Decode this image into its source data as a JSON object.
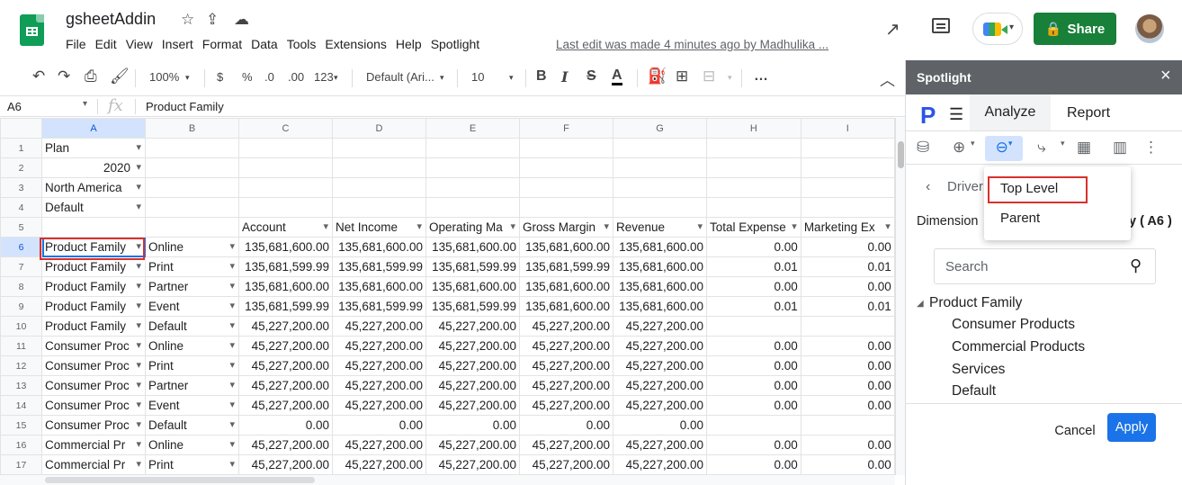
{
  "doc": {
    "title": "gsheetAddin",
    "last_edit": "Last edit was made 4 minutes ago by Madhulika ..."
  },
  "menu": [
    "File",
    "Edit",
    "View",
    "Insert",
    "Format",
    "Data",
    "Tools",
    "Extensions",
    "Help",
    "Spotlight"
  ],
  "header": {
    "share_label": "Share"
  },
  "toolbar": {
    "zoom": "100%",
    "currency": "$",
    "percent": "%",
    "dec_decrease": ".0",
    "dec_increase": ".00",
    "number_format": "123",
    "font": "Default (Ari...",
    "font_size": "10",
    "bold": "B",
    "italic": "I",
    "strike": "S",
    "text_color": "A",
    "more": "…"
  },
  "formula_bar": {
    "cell_ref": "A6",
    "fx": "fx",
    "content": "Product Family"
  },
  "grid": {
    "columns": [
      "A",
      "B",
      "C",
      "D",
      "E",
      "F",
      "G",
      "H",
      "I"
    ],
    "rows": [
      [
        "Plan",
        "",
        "",
        "",
        "",
        "",
        "",
        "",
        ""
      ],
      [
        "2020",
        "",
        "",
        "",
        "",
        "",
        "",
        "",
        ""
      ],
      [
        "North America",
        "",
        "",
        "",
        "",
        "",
        "",
        "",
        ""
      ],
      [
        "Default",
        "",
        "",
        "",
        "",
        "",
        "",
        "",
        ""
      ],
      [
        "",
        "",
        "Account",
        "Net Income",
        "Operating Ma",
        "Gross Margin",
        "Revenue",
        "Total Expense",
        "Marketing Ex"
      ],
      [
        "Product Family",
        "Online",
        "135,681,600.00",
        "135,681,600.00",
        "135,681,600.00",
        "135,681,600.00",
        "135,681,600.00",
        "0.00",
        "0.00"
      ],
      [
        "Product Family",
        "Print",
        "135,681,599.99",
        "135,681,599.99",
        "135,681,599.99",
        "135,681,599.99",
        "135,681,600.00",
        "0.01",
        "0.01"
      ],
      [
        "Product Family",
        "Partner",
        "135,681,600.00",
        "135,681,600.00",
        "135,681,600.00",
        "135,681,600.00",
        "135,681,600.00",
        "0.00",
        "0.00"
      ],
      [
        "Product Family",
        "Event",
        "135,681,599.99",
        "135,681,599.99",
        "135,681,599.99",
        "135,681,600.00",
        "135,681,600.00",
        "0.01",
        "0.01"
      ],
      [
        "Product Family",
        "Default",
        "45,227,200.00",
        "45,227,200.00",
        "45,227,200.00",
        "45,227,200.00",
        "45,227,200.00",
        "",
        ""
      ],
      [
        "Consumer Proc",
        "Online",
        "45,227,200.00",
        "45,227,200.00",
        "45,227,200.00",
        "45,227,200.00",
        "45,227,200.00",
        "0.00",
        "0.00"
      ],
      [
        "Consumer Proc",
        "Print",
        "45,227,200.00",
        "45,227,200.00",
        "45,227,200.00",
        "45,227,200.00",
        "45,227,200.00",
        "0.00",
        "0.00"
      ],
      [
        "Consumer Proc",
        "Partner",
        "45,227,200.00",
        "45,227,200.00",
        "45,227,200.00",
        "45,227,200.00",
        "45,227,200.00",
        "0.00",
        "0.00"
      ],
      [
        "Consumer Proc",
        "Event",
        "45,227,200.00",
        "45,227,200.00",
        "45,227,200.00",
        "45,227,200.00",
        "45,227,200.00",
        "0.00",
        "0.00"
      ],
      [
        "Consumer Proc",
        "Default",
        "0.00",
        "0.00",
        "0.00",
        "0.00",
        "0.00",
        "",
        ""
      ],
      [
        "Commercial Pr",
        "Online",
        "45,227,200.00",
        "45,227,200.00",
        "45,227,200.00",
        "45,227,200.00",
        "45,227,200.00",
        "0.00",
        "0.00"
      ],
      [
        "Commercial Pr",
        "Print",
        "45,227,200.00",
        "45,227,200.00",
        "45,227,200.00",
        "45,227,200.00",
        "45,227,200.00",
        "0.00",
        "0.00"
      ]
    ]
  },
  "panel": {
    "title": "Spotlight",
    "close": "×",
    "logo": "P",
    "tabs": [
      "Analyze",
      "Report"
    ],
    "driver_label": "Driver",
    "dimension_label": "Dimension",
    "dimension_value": "y ( A6 )",
    "zoom_menu": [
      "Top Level",
      "Parent"
    ],
    "search_placeholder": "Search",
    "tree_root": "Product Family",
    "tree_children": [
      "Consumer Products",
      "Commercial Products",
      "Services",
      "Default"
    ],
    "cancel_label": "Cancel",
    "apply_label": "Apply"
  },
  "colors": {
    "share": "#188038",
    "apply": "#1a73e8",
    "panel_header": "#5f6368",
    "highlight": "#d9302c",
    "selection": "#1a73e8"
  }
}
